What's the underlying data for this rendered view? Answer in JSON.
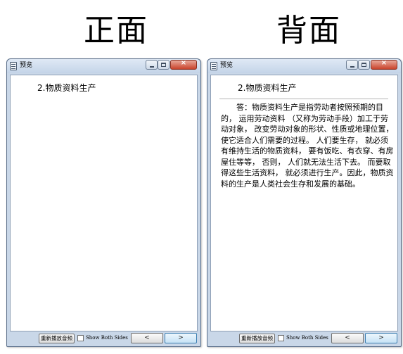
{
  "headings": {
    "front": "正面",
    "back": "背面"
  },
  "window": {
    "title": "预览",
    "controls": {
      "minimize": "minimize-icon",
      "maximize": "maximize-icon",
      "close": "close-icon"
    }
  },
  "card": {
    "question": "2.物质资料生产",
    "answer": "答：物质资料生产是指劳动者按照预期的目的，  运用劳动资料 （又称为劳动手段）加工于劳动对象，  改变劳动对象的形状、性质或地理位置，  使它适合人们需要的过程。 人们要生存，  就必须有维持生活的物质资料，  要有饭吃、有衣穿、有房屋住等等，  否则，  人们就无法生活下去。  而要取得这些生活资料，  就必须进行生产。因此，物质资料的生产是人类社会生存和发展的基础。"
  },
  "bottombar": {
    "replay_label": "重新播放音频",
    "show_both_label": "Show Both Sides",
    "show_both_checked": false,
    "prev_label": "<",
    "next_label": ">"
  },
  "colors": {
    "window_frame": "#c9d7e8",
    "close_button": "#c9442c",
    "next_button_accent": "#3c7fb1"
  }
}
